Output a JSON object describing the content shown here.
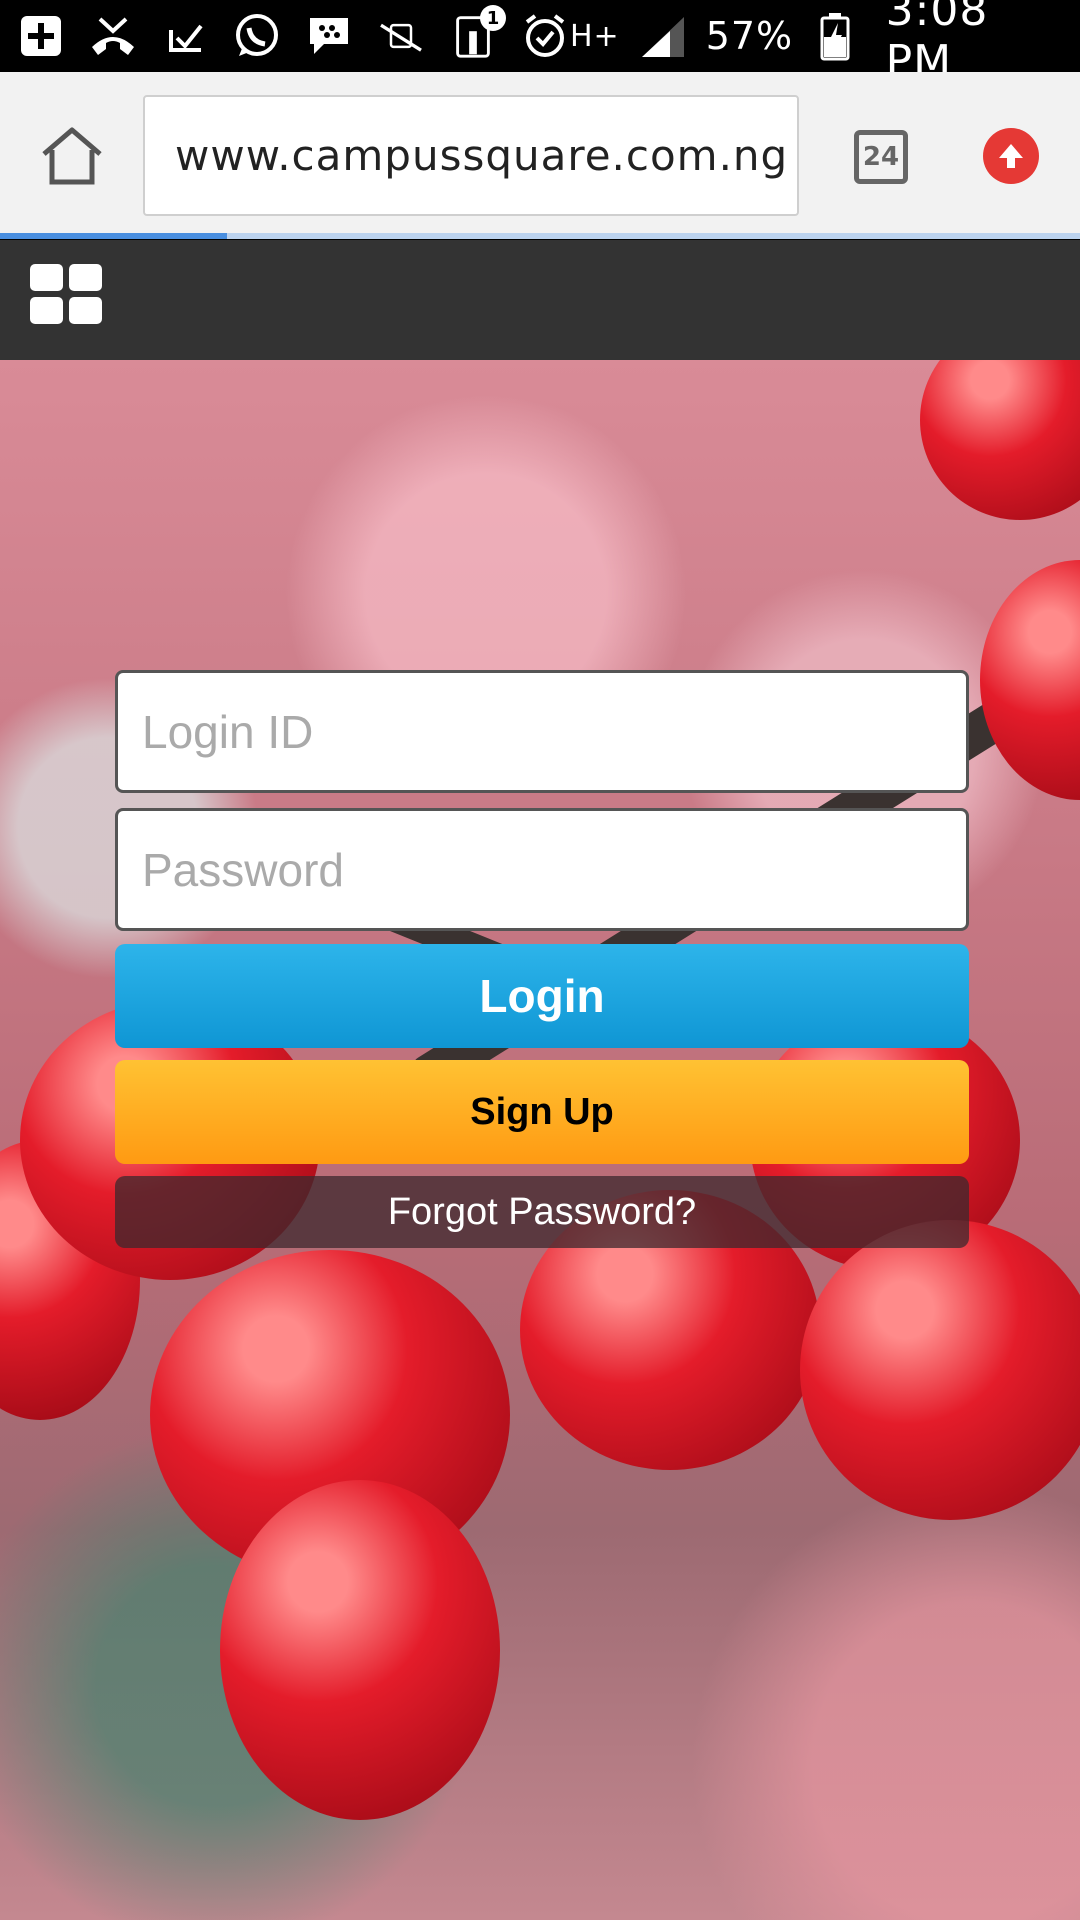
{
  "status_bar": {
    "battery": "57%",
    "time": "3:08 PM",
    "network": "H+",
    "notification_badge": "1",
    "icons": [
      "add-box-icon",
      "missed-call-icon",
      "check-icon",
      "whatsapp-icon",
      "bbm-icon",
      "mute-icon",
      "hotspot-icon",
      "alarm-icon",
      "signal-icon",
      "battery-icon"
    ]
  },
  "browser": {
    "url": "www.campussquare.com.ng",
    "tab_count": "24",
    "load_progress": 0.21
  },
  "login_form": {
    "login_id_placeholder": "Login ID",
    "password_placeholder": "Password",
    "login_label": "Login",
    "signup_label": "Sign Up",
    "forgot_label": "Forgot Password?"
  },
  "colors": {
    "nav_bar": "#333333",
    "login_button": "#1aa5e0",
    "signup_button": "#ffad1f",
    "upload_button": "#e53935"
  }
}
